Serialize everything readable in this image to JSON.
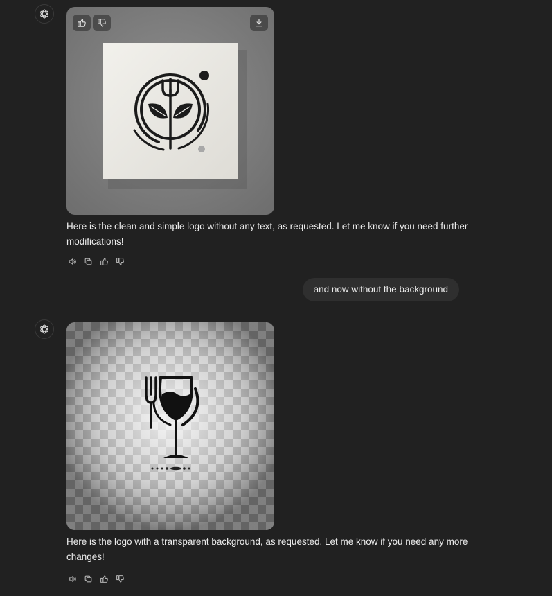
{
  "conversation": {
    "messages": [
      {
        "role": "assistant",
        "image": {
          "name": "logo-with-gray-background",
          "buttons": {
            "like": "thumbs-up-icon",
            "dislike": "thumbs-down-icon",
            "download": "download-icon"
          }
        },
        "text": "Here is the clean and simple logo without any text, as requested. Let me know if you need further modifications!"
      },
      {
        "role": "user",
        "text": "and now without the background"
      },
      {
        "role": "assistant",
        "image": {
          "name": "logo-transparent-background"
        },
        "text": "Here is the logo with a transparent background, as requested. Let me know if you need any more changes!"
      }
    ],
    "message_actions": [
      "read-aloud-icon",
      "copy-icon",
      "thumbs-up-icon",
      "thumbs-down-icon"
    ]
  },
  "colors": {
    "background": "#212121",
    "user_bubble": "#2f2f2f",
    "text": "#ececec",
    "icon": "#b4b4b4"
  }
}
